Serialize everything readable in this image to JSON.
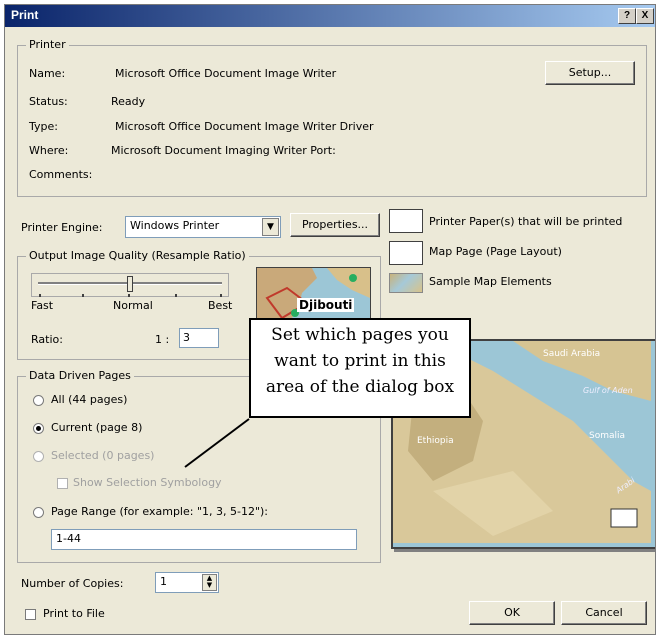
{
  "title": "Print",
  "titlebar": {
    "help": "?",
    "close": "X"
  },
  "printer": {
    "group_label": "Printer",
    "name_label": "Name:",
    "name_value": "Microsoft Office Document Image Writer",
    "status_label": "Status:",
    "status_value": "Ready",
    "type_label": "Type:",
    "type_value": "Microsoft Office Document Image Writer Driver",
    "where_label": "Where:",
    "where_value": "Microsoft Document Imaging Writer Port:",
    "comments_label": "Comments:",
    "setup_button": "Setup..."
  },
  "engine": {
    "label": "Printer Engine:",
    "value": "Windows Printer",
    "properties_button": "Properties..."
  },
  "legend": {
    "paper": "Printer Paper(s) that will be printed",
    "map_page": "Map Page (Page Layout)",
    "sample": "Sample Map Elements"
  },
  "quality": {
    "group_label": "Output Image Quality (Resample Ratio)",
    "fast": "Fast",
    "normal": "Normal",
    "best": "Best",
    "slider_level": 0.5,
    "ratio_label": "Ratio:",
    "ratio_prefix": "1 :",
    "ratio_value": "3",
    "preview_label": "Djibouti"
  },
  "ddp": {
    "group_label": "Data Driven Pages",
    "all": "All (44 pages)",
    "current": "Current (page 8)",
    "selected": "Selected (0 pages)",
    "show_selection": "Show Selection Symbology",
    "range": "Page Range (for example: \"1, 3, 5-12\"):",
    "range_value": "1-44"
  },
  "map_preview": {
    "labels": [
      "Saudi Arabia",
      "Gulf of Aden",
      "Somalia",
      "Ethiopia",
      "Arabi"
    ]
  },
  "callout": {
    "text": "Set which pages you want to print in this area of the dialog box"
  },
  "copies": {
    "label": "Number of Copies:",
    "value": "1"
  },
  "print_to_file": "Print to File",
  "ok_button": "OK",
  "cancel_button": "Cancel",
  "colors": {
    "title_start": "#0a246a",
    "title_end": "#a6caf0",
    "dialog_bg": "#ece9d8",
    "sea": "#9cc6d6",
    "land": "#d9c89a"
  }
}
